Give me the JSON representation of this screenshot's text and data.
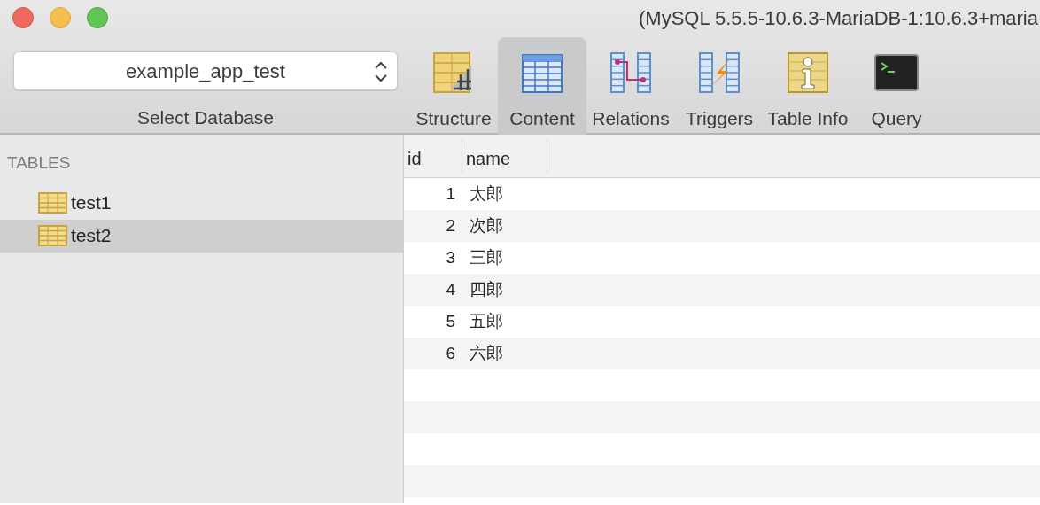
{
  "window": {
    "title": "(MySQL 5.5.5-10.6.3-MariaDB-1:10.6.3+maria"
  },
  "database_selector": {
    "value": "example_app_test",
    "label": "Select Database"
  },
  "toolbar": [
    {
      "label": "Structure",
      "kind": "structure",
      "selected": false
    },
    {
      "label": "Content",
      "kind": "content",
      "selected": true
    },
    {
      "label": "Relations",
      "kind": "relations",
      "selected": false
    },
    {
      "label": "Triggers",
      "kind": "triggers",
      "selected": false
    },
    {
      "label": "Table Info",
      "kind": "info",
      "selected": false
    },
    {
      "label": "Query",
      "kind": "query",
      "selected": false
    }
  ],
  "sidebar": {
    "heading": "TABLES",
    "items": [
      {
        "label": "test1",
        "selected": false
      },
      {
        "label": "test2",
        "selected": true
      }
    ]
  },
  "table": {
    "columns": [
      "id",
      "name"
    ],
    "rows": [
      [
        "1",
        "太郎"
      ],
      [
        "2",
        "次郎"
      ],
      [
        "3",
        "三郎"
      ],
      [
        "4",
        "四郎"
      ],
      [
        "5",
        "五郎"
      ],
      [
        "6",
        "六郎"
      ]
    ]
  }
}
